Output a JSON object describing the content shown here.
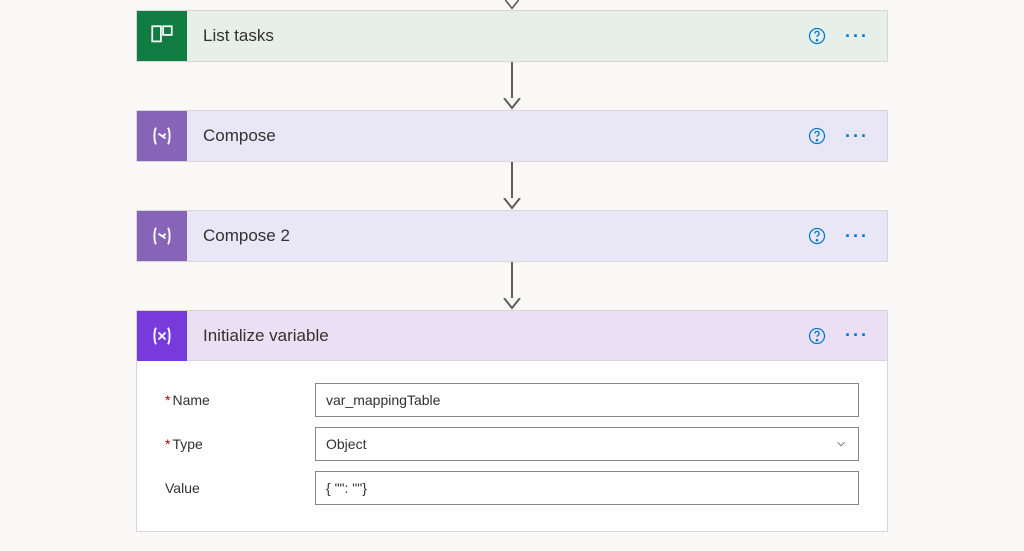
{
  "steps": {
    "listTasks": {
      "title": "List tasks"
    },
    "compose": {
      "title": "Compose"
    },
    "compose2": {
      "title": "Compose 2"
    },
    "initVar": {
      "title": "Initialize variable",
      "fields": {
        "nameLabel": "Name",
        "nameValue": "var_mappingTable",
        "typeLabel": "Type",
        "typeValue": "Object",
        "valueLabel": "Value",
        "valueValue": "{ \"\": \"\"}"
      }
    }
  }
}
